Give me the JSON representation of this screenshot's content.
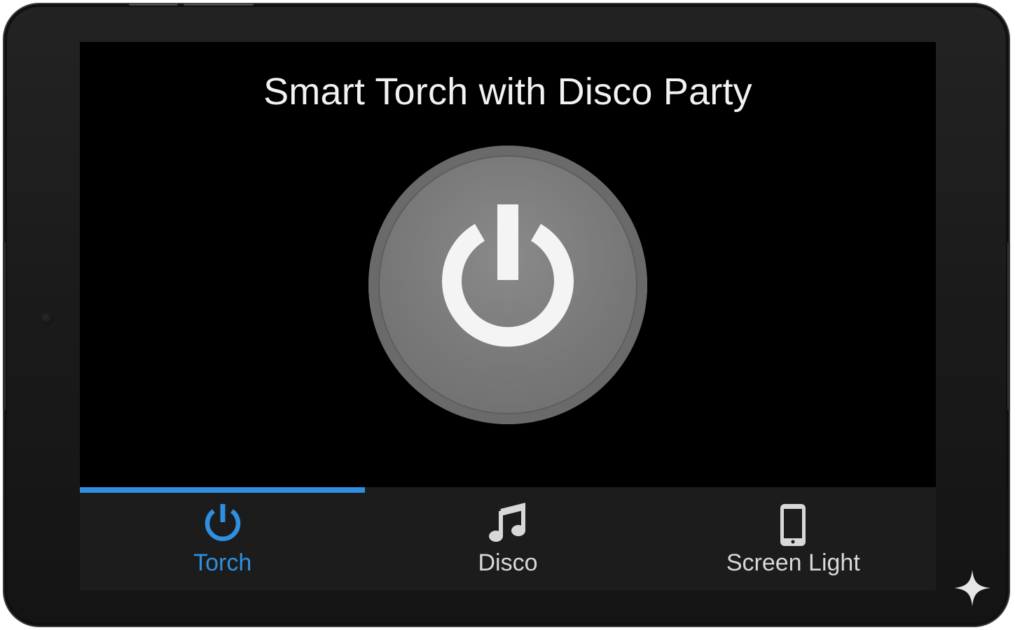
{
  "app": {
    "title": "Smart Torch with Disco Party"
  },
  "power_button": {
    "icon": "power-icon",
    "state": "off",
    "color": "#7a7a7a"
  },
  "tabs": [
    {
      "label": "Torch",
      "icon": "power-icon",
      "active": true
    },
    {
      "label": "Disco",
      "icon": "music-note-icon",
      "active": false
    },
    {
      "label": "Screen Light",
      "icon": "phone-icon",
      "active": false
    }
  ],
  "colors": {
    "accent": "#2f8fe0",
    "screen_bg": "#000000",
    "tabbar_bg": "#1c1c1c",
    "text": "#f2f2f2"
  }
}
